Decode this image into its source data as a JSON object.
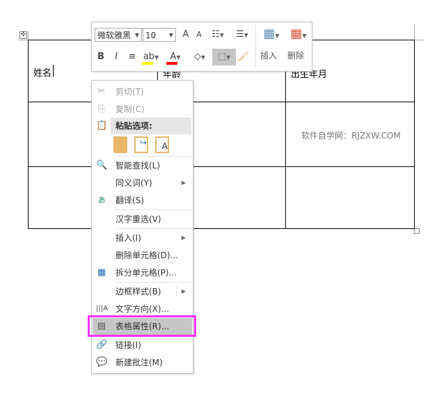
{
  "table": {
    "cells": [
      "姓名",
      "年龄",
      "出生年月"
    ]
  },
  "watermark": "软件自学网：RJZXW.COM",
  "mini_toolbar": {
    "font_name": "微软雅黑",
    "font_size": "10",
    "bold": "B",
    "italic": "I",
    "grow_font": "A",
    "shrink_font": "A",
    "font_color": "A",
    "insert_label": "插入",
    "delete_label": "删除",
    "highlight_color": "#ffff00",
    "font_color_value": "#ff0000"
  },
  "context_menu": {
    "cut": "剪切(T)",
    "copy": "复制(C)",
    "paste_options": "粘贴选项:",
    "smart_lookup": "智能查找(L)",
    "synonyms": "同义词(Y)",
    "translate": "翻译(S)",
    "hanzi_reselect": "汉字重选(V)",
    "insert": "插入(I)",
    "delete_cells": "删除单元格(D)...",
    "split_cells": "拆分单元格(P)...",
    "border_styles": "边框样式(B)",
    "text_direction": "文字方向(X)...",
    "table_properties": "表格属性(R)...",
    "link": "链接(I)",
    "new_comment": "新建批注(M)"
  },
  "highlight_box_color": "#ff33ff"
}
